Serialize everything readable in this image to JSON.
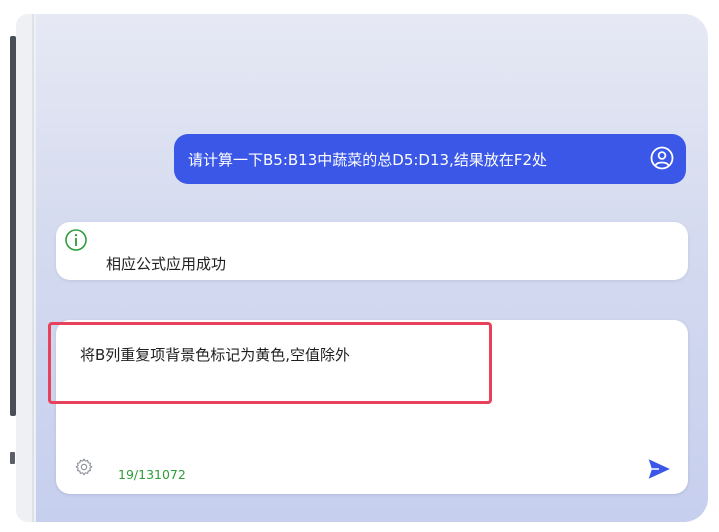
{
  "chat": {
    "user_message": "请计算一下B5:B13中蔬菜的总D5:D13,结果放在F2处",
    "user_avatar_icon": "user-circle-icon",
    "system_icon": "info-circle-icon",
    "system_message": "相应公式应用成功"
  },
  "composer": {
    "input_text": "将B列重复项背景色标记为黄色,空值除外",
    "char_count": "19/131072",
    "settings_icon": "gear-icon",
    "send_icon": "send-icon"
  },
  "colors": {
    "accent": "#3a57e8",
    "highlight": "#e8415c",
    "count_green": "#2e9d3a"
  }
}
